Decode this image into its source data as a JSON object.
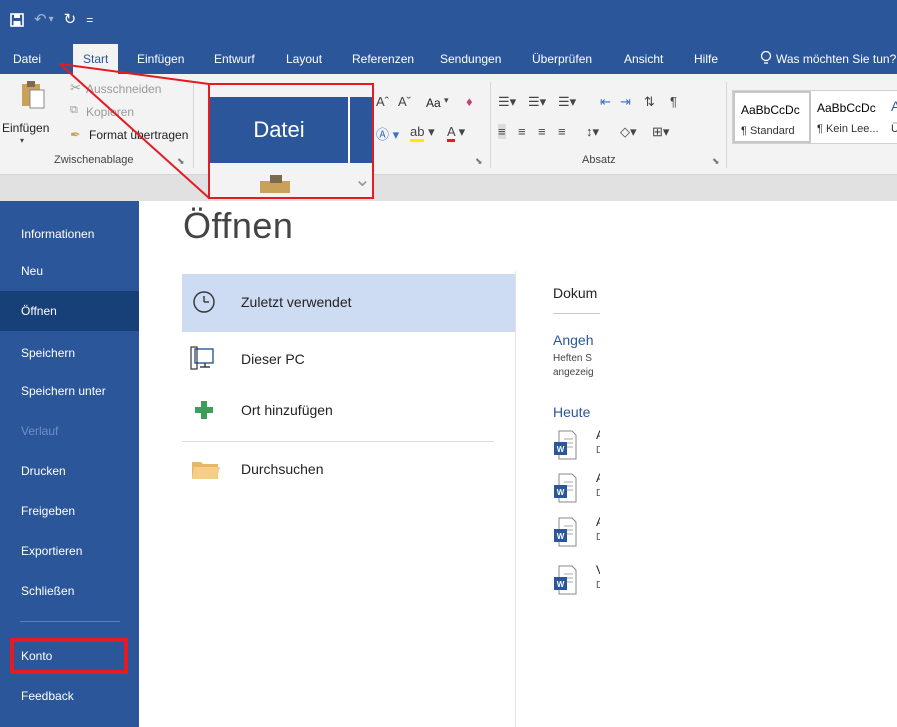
{
  "qat": {
    "save_icon": "save-icon",
    "undo": "↶",
    "undo_dd": "▾",
    "redo": "↻",
    "customize": "="
  },
  "tabs": [
    "Datei",
    "Start",
    "Einfügen",
    "Entwurf",
    "Layout",
    "Referenzen",
    "Sendungen",
    "Überprüfen",
    "Ansicht",
    "Hilfe"
  ],
  "tell_me": "Was möchten Sie tun?",
  "ribbon": {
    "paste": "Einfügen",
    "cut": "Ausschneiden",
    "copy": "Kopieren",
    "format_painter": "Format übertragen",
    "clipboard_label": "Zwischenablage",
    "paragraph_label": "Absatz",
    "font_case": "Aa",
    "style1_preview": "AaBbCcDc",
    "style1_name": "¶ Standard",
    "style2_preview": "AaBbCcDc",
    "style2_name": "¶ Kein Lee...",
    "style3_preview": "A",
    "style3_name": "Ü"
  },
  "zoom_label": "Datei",
  "backstage": {
    "nav": [
      {
        "label": "Informationen",
        "state": "normal"
      },
      {
        "label": "Neu",
        "state": "normal"
      },
      {
        "label": "Öffnen",
        "state": "active"
      },
      {
        "label": "Speichern",
        "state": "normal"
      },
      {
        "label": "Speichern unter",
        "state": "normal"
      },
      {
        "label": "Verlauf",
        "state": "disabled"
      },
      {
        "label": "Drucken",
        "state": "normal"
      },
      {
        "label": "Freigeben",
        "state": "normal"
      },
      {
        "label": "Exportieren",
        "state": "normal"
      },
      {
        "label": "Schließen",
        "state": "normal"
      },
      {
        "label": "Konto",
        "state": "highlighted"
      },
      {
        "label": "Feedback",
        "state": "normal"
      }
    ],
    "title": "Öffnen",
    "locations": [
      {
        "label": "Zuletzt verwendet",
        "icon": "clock-icon",
        "selected": true
      },
      {
        "label": "Dieser PC",
        "icon": "computer-icon",
        "selected": false
      },
      {
        "label": "Ort hinzufügen",
        "icon": "plus-icon",
        "selected": false
      },
      {
        "label": "Durchsuchen",
        "icon": "folder-icon",
        "selected": false
      }
    ],
    "recent": {
      "header": "Dokum",
      "pinned_title": "Angeh",
      "pinned_line1": "Heften S",
      "pinned_line2": "angezeig",
      "today": "Heute",
      "docs": [
        {
          "a": "A",
          "b": "D"
        },
        {
          "a": "A",
          "b": "D"
        },
        {
          "a": "A",
          "b": "D"
        },
        {
          "a": "V",
          "b": "D"
        }
      ]
    }
  },
  "colors": {
    "word_blue": "#2b579a",
    "nav_active": "#173f78",
    "highlight_red": "#e31b23",
    "selection": "#cddcf3"
  }
}
